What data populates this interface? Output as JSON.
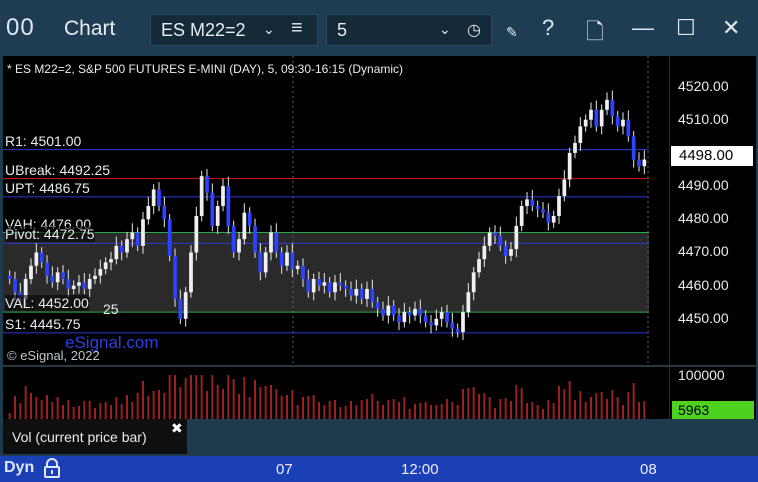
{
  "titlebar": {
    "app_icon": "00",
    "title": "Chart",
    "symbol": "ES M22=2",
    "interval": "5",
    "help": "?"
  },
  "chart": {
    "header": "* ES M22=2, S&P 500 FUTURES E-MINI (DAY), 5, 09:30-16:15 (Dynamic)",
    "levels": [
      {
        "label": "R1: 4501.00",
        "price": 4501.0,
        "color": "#2a3bd6"
      },
      {
        "label": "UBreak: 4492.25",
        "price": 4492.25,
        "color": "#e01818"
      },
      {
        "label": "UPT: 4486.75",
        "price": 4486.75,
        "color": "#2a3bd6"
      },
      {
        "label": "VAH: 4476.00",
        "price": 4476.0,
        "color": "#2aa84a"
      },
      {
        "label": "Pivot: 4472.75",
        "price": 4472.75,
        "color": "#2a3bd6"
      },
      {
        "label": "VAL: 4452.00",
        "price": 4452.0,
        "color": "#2aa84a"
      },
      {
        "label": "S1: 4445.75",
        "price": 4445.75,
        "color": "#2a3bd6"
      }
    ],
    "overlay_25": "25",
    "watermark_link": "eSignal.com",
    "copyright": "© eSignal, 2022",
    "current_price": "4498.00",
    "price_ticks": [
      "4520.00",
      "4510.00",
      "4490.00",
      "4480.00",
      "4470.00",
      "4460.00",
      "4450.00"
    ]
  },
  "volume": {
    "tick": "100000",
    "current": "5963",
    "study_label": "Vol (current price bar)",
    "close": "✖"
  },
  "time_axis": {
    "mode": "Dyn",
    "lock_icon": "lock-icon",
    "labels": [
      "07",
      "12:00",
      "08"
    ]
  },
  "chart_data": {
    "type": "candlestick",
    "title": "* ES M22=2, S&P 500 FUTURES E-MINI (DAY), 5, 09:30-16:15 (Dynamic)",
    "ylim": [
      4440,
      4528
    ],
    "y_ticks": [
      4520,
      4510,
      4490,
      4480,
      4470,
      4460,
      4450
    ],
    "x_labels": [
      "07",
      "12:00",
      "08"
    ],
    "current_price": 4498.0,
    "closes": [
      4462,
      4458,
      4456,
      4462,
      4466,
      4470,
      4467,
      4463,
      4461,
      4464,
      4462,
      4459,
      4460,
      4461,
      4459,
      4462,
      4463,
      4465,
      4467,
      4468,
      4472,
      4470,
      4474,
      4476,
      4472,
      4480,
      4484,
      4489,
      4484,
      4480,
      4469,
      4456,
      4450,
      4458,
      4470,
      4481,
      4493,
      4488,
      4478,
      4484,
      4490,
      4478,
      4470,
      4474,
      4482,
      4478,
      4470,
      4464,
      4470,
      4476,
      4470,
      4466,
      4470,
      4465,
      4466,
      4462,
      4458,
      4462,
      4460,
      4461,
      4458,
      4461,
      4460,
      4459,
      4457,
      4459,
      4456,
      4459,
      4455,
      4453,
      4451,
      4454,
      4451,
      4449,
      4452,
      4451,
      4453,
      4451,
      4449,
      4448,
      4450,
      4452,
      4449,
      4447,
      4446,
      4452,
      4458,
      4464,
      4468,
      4472,
      4476,
      4475,
      4472,
      4469,
      4471,
      4478,
      4484,
      4486,
      4484,
      4483,
      4482,
      4479,
      4481,
      4487,
      4492,
      4500,
      4503,
      4508,
      4510,
      4513,
      4508,
      4513,
      4516,
      4511,
      4508,
      4510,
      4505,
      4498,
      4496,
      4498
    ]
  }
}
